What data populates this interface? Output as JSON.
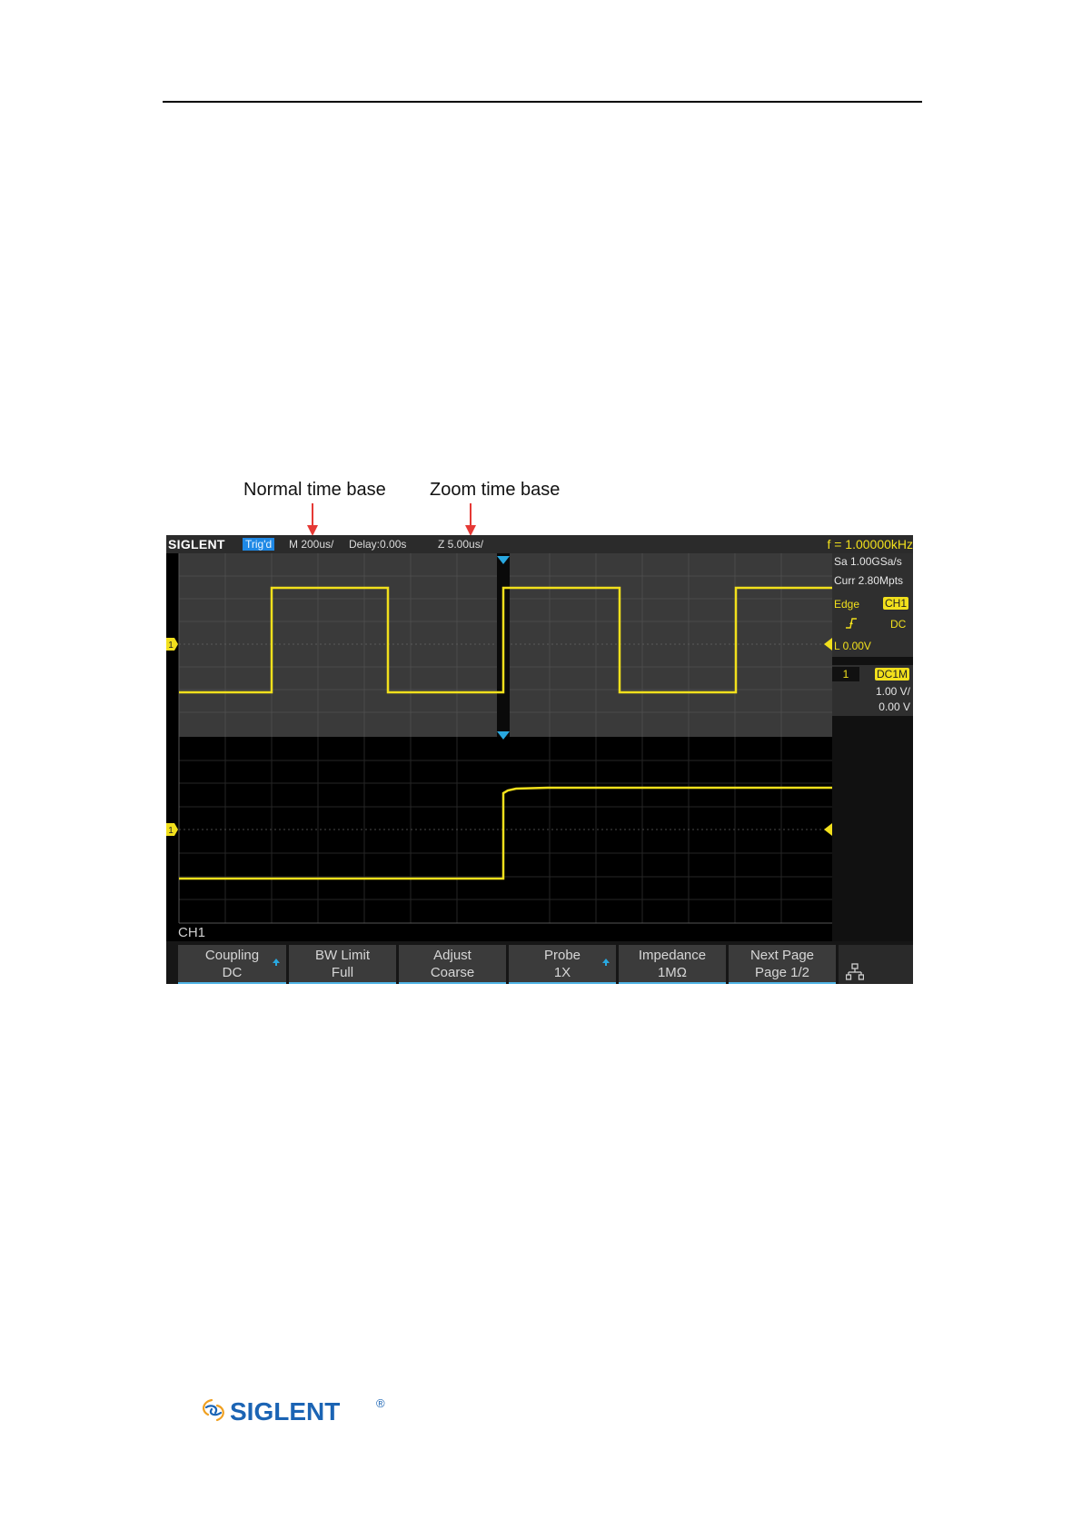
{
  "callouts": {
    "normal": "Normal time base",
    "zoom": "Zoom time base"
  },
  "scope": {
    "brand": "SIGLENT",
    "status": "Trig'd",
    "main_timebase": "M 200us/",
    "delay": "Delay:0.00s",
    "zoom_timebase": "Z 5.00us/",
    "frequency": "f = 1.00000kHz",
    "sample_rate": "Sa 1.00GSa/s",
    "memory": "Curr 2.80Mpts",
    "trigger": {
      "type": "Edge",
      "source": "CH1",
      "coupling": "DC",
      "level": "L  0.00V"
    },
    "channel": {
      "number": "1",
      "coupling_tag": "DC1M",
      "scale": "1.00 V/",
      "offset": "0.00 V"
    },
    "channel_marker": "1",
    "menu_title": "CH1",
    "softkeys": [
      {
        "label": "Coupling",
        "value": "DC",
        "has_arrow": true
      },
      {
        "label": "BW Limit",
        "value": "Full",
        "has_arrow": false
      },
      {
        "label": "Adjust",
        "value": "Coarse",
        "has_arrow": false
      },
      {
        "label": "Probe",
        "value": "1X",
        "has_arrow": true
      },
      {
        "label": "Impedance",
        "value": "1MΩ",
        "has_arrow": false
      },
      {
        "label": "Next Page",
        "value": "Page 1/2",
        "has_arrow": false
      }
    ]
  },
  "footer": {
    "logo_text": "SIGLENT",
    "registered": "®"
  },
  "colors": {
    "trace": "#f2e01c",
    "accent": "#1e88e5",
    "callout_arrow": "#e53935"
  }
}
